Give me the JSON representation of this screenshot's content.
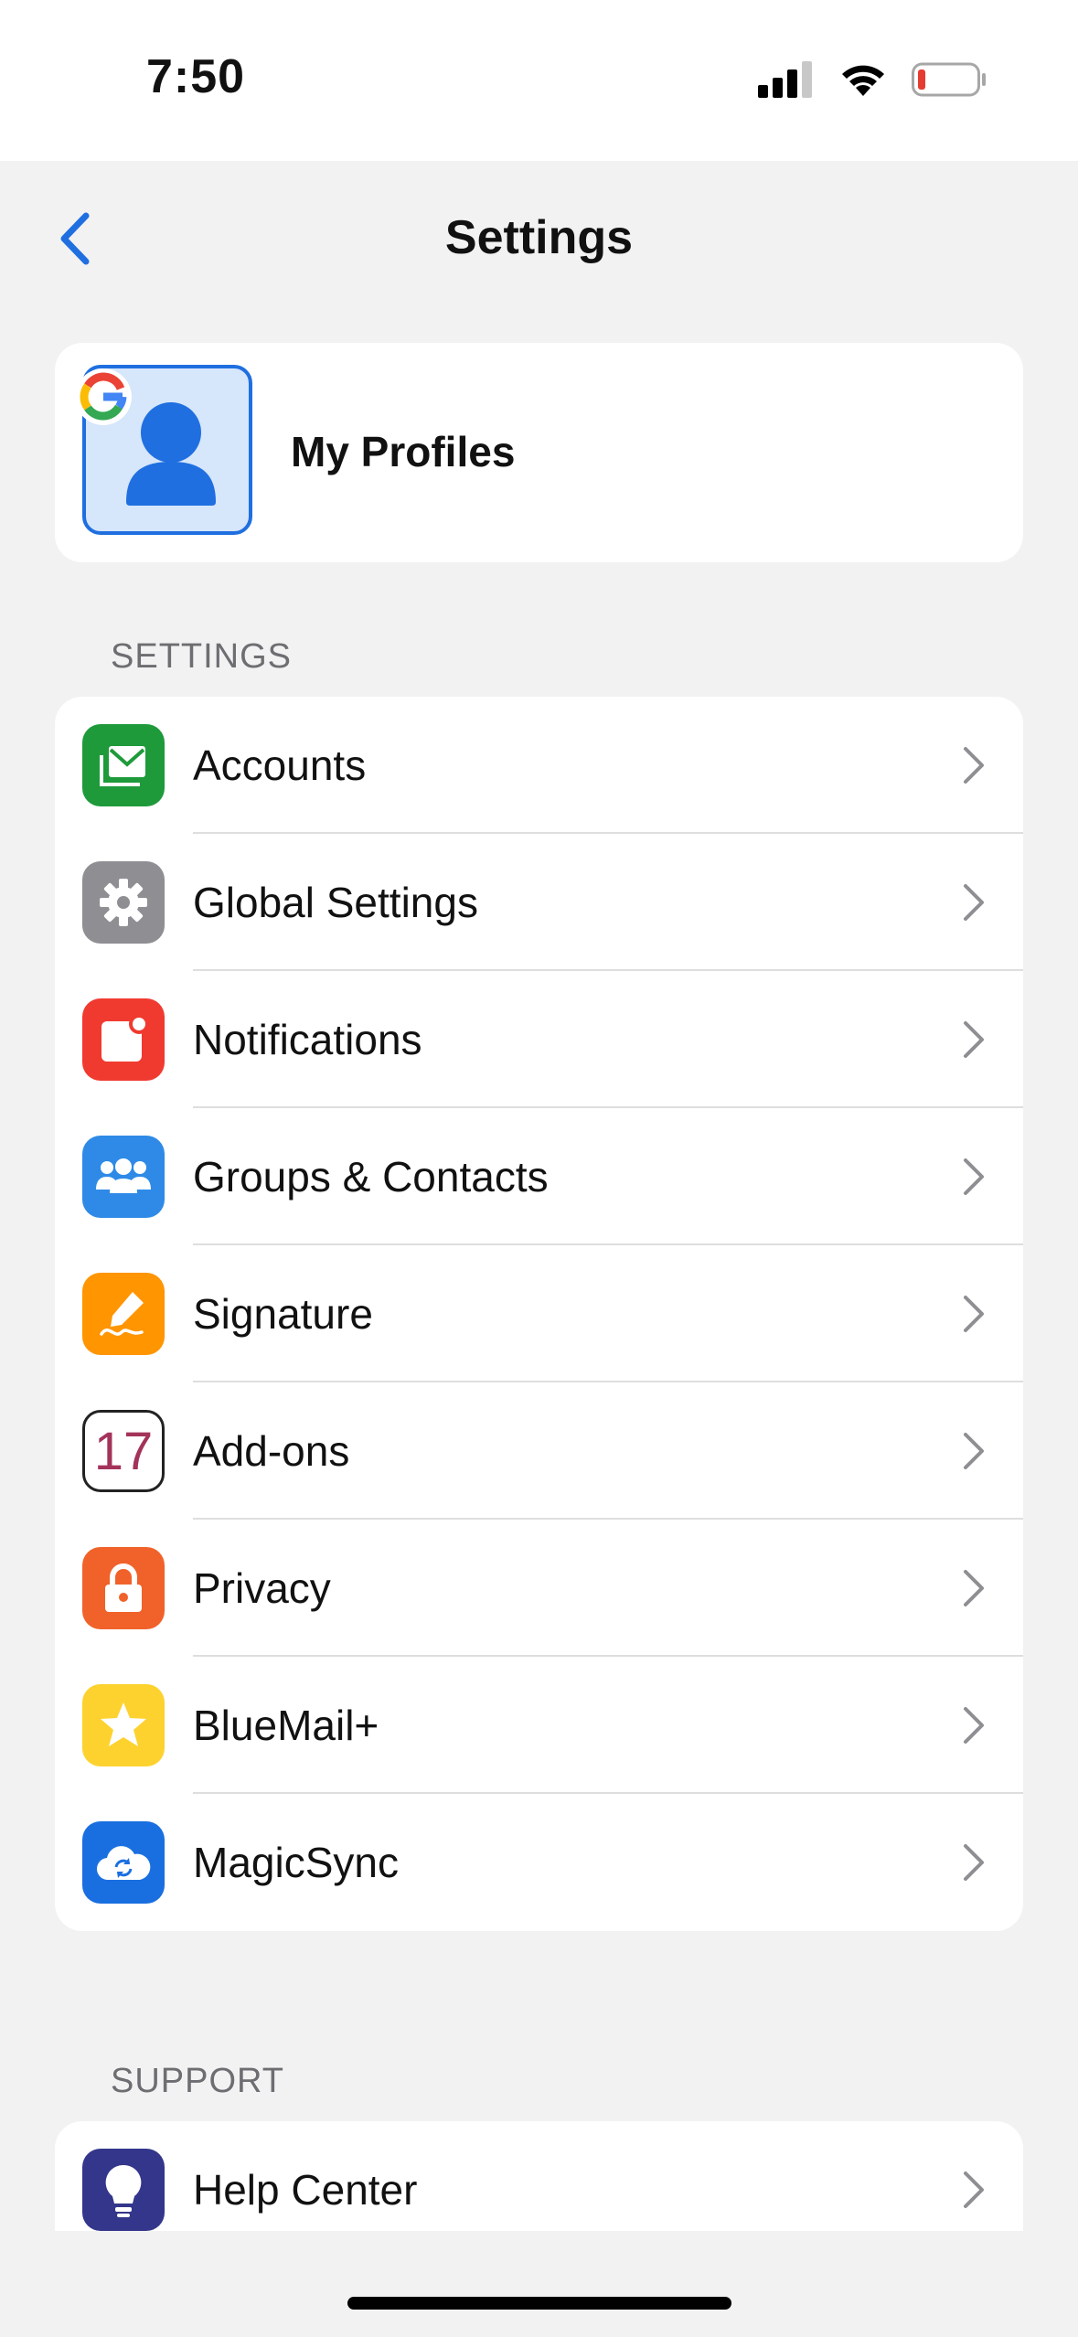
{
  "status": {
    "time": "7:50"
  },
  "nav": {
    "title": "Settings"
  },
  "profile": {
    "label": "My Profiles"
  },
  "sections": {
    "settings_header": "SETTINGS",
    "support_header": "SUPPORT"
  },
  "settings_items": [
    {
      "label": "Accounts",
      "icon": "mail-icon",
      "color": "#1e9a3a"
    },
    {
      "label": "Global Settings",
      "icon": "gear-icon",
      "color": "#8e8e93"
    },
    {
      "label": "Notifications",
      "icon": "notification-badge-icon",
      "color": "#f03a30"
    },
    {
      "label": "Groups & Contacts",
      "icon": "group-icon",
      "color": "#2e8ae6"
    },
    {
      "label": "Signature",
      "icon": "pen-signature-icon",
      "color": "#ff9500"
    },
    {
      "label": "Add-ons",
      "icon": "calendar-icon",
      "color": "#ffffff",
      "calendar_day": "17"
    },
    {
      "label": "Privacy",
      "icon": "lock-icon",
      "color": "#f0622a"
    },
    {
      "label": "BlueMail+",
      "icon": "star-icon",
      "color": "#fdd22e"
    },
    {
      "label": "MagicSync",
      "icon": "cloud-sync-icon",
      "color": "#1a6fe0"
    }
  ],
  "support_items": [
    {
      "label": "Help Center",
      "icon": "lightbulb-icon",
      "color": "#33368a"
    }
  ]
}
